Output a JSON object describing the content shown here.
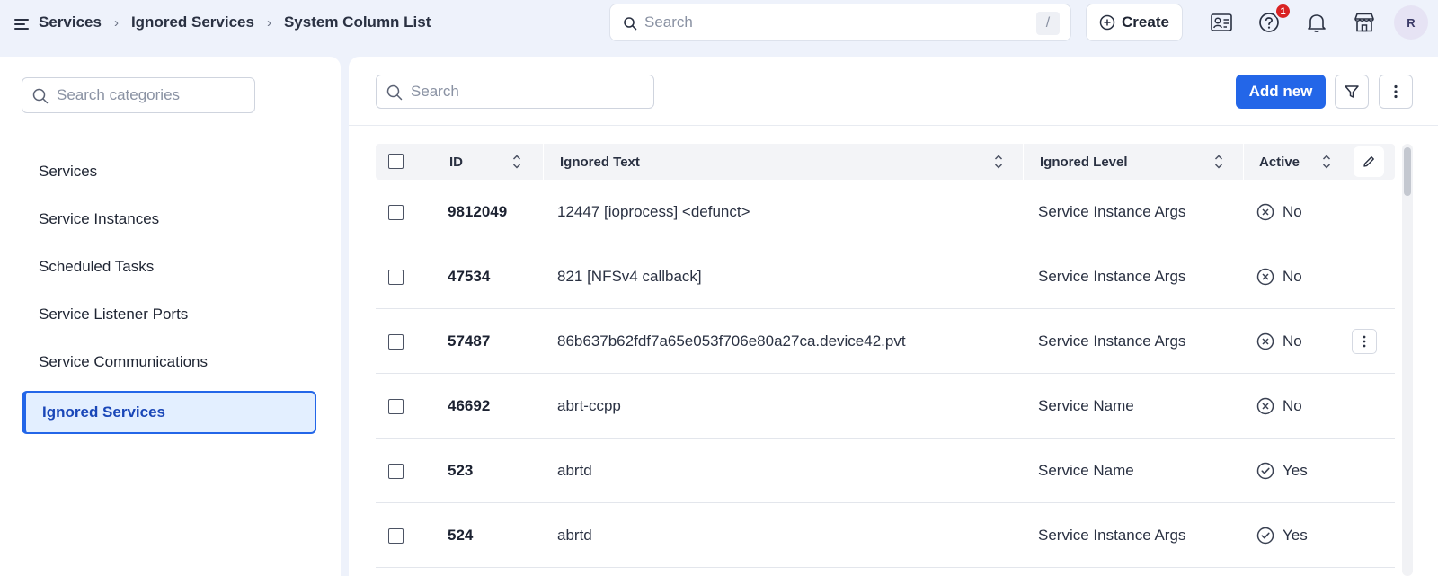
{
  "colors": {
    "accent": "#2366e8",
    "active_bg": "#e3efff",
    "badge": "#d92323"
  },
  "header": {
    "breadcrumb": [
      "Services",
      "Ignored Services",
      "System Column List"
    ],
    "search_placeholder": "Search",
    "search_shortcut": "/",
    "create_label": "Create",
    "notification_count": "1",
    "avatar_initial": "R",
    "icons": [
      "menu-icon",
      "contact-card-icon",
      "help-icon",
      "bell-icon",
      "store-icon"
    ]
  },
  "sidebar": {
    "search_placeholder": "Search categories",
    "items": [
      {
        "label": "Services",
        "active": false
      },
      {
        "label": "Service Instances",
        "active": false
      },
      {
        "label": "Scheduled Tasks",
        "active": false
      },
      {
        "label": "Service Listener Ports",
        "active": false
      },
      {
        "label": "Service Communications",
        "active": false
      },
      {
        "label": "Ignored Services",
        "active": true
      }
    ]
  },
  "main": {
    "search_placeholder": "Search",
    "add_label": "Add new",
    "columns": [
      "ID",
      "Ignored Text",
      "Ignored Level",
      "Active"
    ],
    "rows": [
      {
        "id": "9812049",
        "text": "12447 [ioprocess] <defunct>",
        "level": "Service Instance Args",
        "active": "No"
      },
      {
        "id": "47534",
        "text": "821 [NFSv4 callback]",
        "level": "Service Instance Args",
        "active": "No"
      },
      {
        "id": "57487",
        "text": "86b637b62fdf7a65e053f706e80a27ca.device42.pvt",
        "level": "Service Instance Args",
        "active": "No"
      },
      {
        "id": "46692",
        "text": "abrt-ccpp",
        "level": "Service Name",
        "active": "No"
      },
      {
        "id": "523",
        "text": "abrtd",
        "level": "Service Name",
        "active": "Yes"
      },
      {
        "id": "524",
        "text": "abrtd",
        "level": "Service Instance Args",
        "active": "Yes"
      }
    ]
  }
}
